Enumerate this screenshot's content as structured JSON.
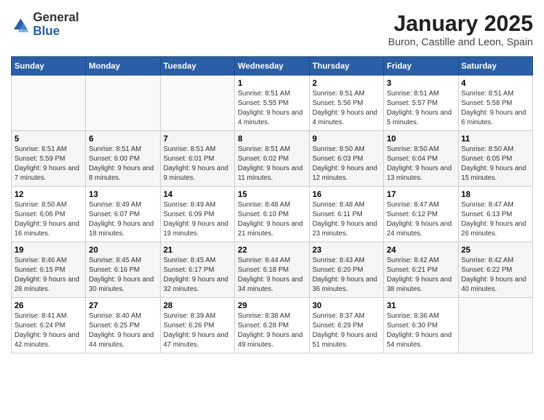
{
  "header": {
    "logo_general": "General",
    "logo_blue": "Blue",
    "title": "January 2025",
    "subtitle": "Buron, Castille and Leon, Spain"
  },
  "columns": [
    "Sunday",
    "Monday",
    "Tuesday",
    "Wednesday",
    "Thursday",
    "Friday",
    "Saturday"
  ],
  "weeks": [
    [
      {
        "day": "",
        "info": ""
      },
      {
        "day": "",
        "info": ""
      },
      {
        "day": "",
        "info": ""
      },
      {
        "day": "1",
        "info": "Sunrise: 8:51 AM\nSunset: 5:55 PM\nDaylight: 9 hours and 4 minutes."
      },
      {
        "day": "2",
        "info": "Sunrise: 8:51 AM\nSunset: 5:56 PM\nDaylight: 9 hours and 4 minutes."
      },
      {
        "day": "3",
        "info": "Sunrise: 8:51 AM\nSunset: 5:57 PM\nDaylight: 9 hours and 5 minutes."
      },
      {
        "day": "4",
        "info": "Sunrise: 8:51 AM\nSunset: 5:58 PM\nDaylight: 9 hours and 6 minutes."
      }
    ],
    [
      {
        "day": "5",
        "info": "Sunrise: 8:51 AM\nSunset: 5:59 PM\nDaylight: 9 hours and 7 minutes."
      },
      {
        "day": "6",
        "info": "Sunrise: 8:51 AM\nSunset: 6:00 PM\nDaylight: 9 hours and 8 minutes."
      },
      {
        "day": "7",
        "info": "Sunrise: 8:51 AM\nSunset: 6:01 PM\nDaylight: 9 hours and 9 minutes."
      },
      {
        "day": "8",
        "info": "Sunrise: 8:51 AM\nSunset: 6:02 PM\nDaylight: 9 hours and 11 minutes."
      },
      {
        "day": "9",
        "info": "Sunrise: 8:50 AM\nSunset: 6:03 PM\nDaylight: 9 hours and 12 minutes."
      },
      {
        "day": "10",
        "info": "Sunrise: 8:50 AM\nSunset: 6:04 PM\nDaylight: 9 hours and 13 minutes."
      },
      {
        "day": "11",
        "info": "Sunrise: 8:50 AM\nSunset: 6:05 PM\nDaylight: 9 hours and 15 minutes."
      }
    ],
    [
      {
        "day": "12",
        "info": "Sunrise: 8:50 AM\nSunset: 6:06 PM\nDaylight: 9 hours and 16 minutes."
      },
      {
        "day": "13",
        "info": "Sunrise: 8:49 AM\nSunset: 6:07 PM\nDaylight: 9 hours and 18 minutes."
      },
      {
        "day": "14",
        "info": "Sunrise: 8:49 AM\nSunset: 6:09 PM\nDaylight: 9 hours and 19 minutes."
      },
      {
        "day": "15",
        "info": "Sunrise: 8:48 AM\nSunset: 6:10 PM\nDaylight: 9 hours and 21 minutes."
      },
      {
        "day": "16",
        "info": "Sunrise: 8:48 AM\nSunset: 6:11 PM\nDaylight: 9 hours and 23 minutes."
      },
      {
        "day": "17",
        "info": "Sunrise: 8:47 AM\nSunset: 6:12 PM\nDaylight: 9 hours and 24 minutes."
      },
      {
        "day": "18",
        "info": "Sunrise: 8:47 AM\nSunset: 6:13 PM\nDaylight: 9 hours and 26 minutes."
      }
    ],
    [
      {
        "day": "19",
        "info": "Sunrise: 8:46 AM\nSunset: 6:15 PM\nDaylight: 9 hours and 28 minutes."
      },
      {
        "day": "20",
        "info": "Sunrise: 8:45 AM\nSunset: 6:16 PM\nDaylight: 9 hours and 30 minutes."
      },
      {
        "day": "21",
        "info": "Sunrise: 8:45 AM\nSunset: 6:17 PM\nDaylight: 9 hours and 32 minutes."
      },
      {
        "day": "22",
        "info": "Sunrise: 8:44 AM\nSunset: 6:18 PM\nDaylight: 9 hours and 34 minutes."
      },
      {
        "day": "23",
        "info": "Sunrise: 8:43 AM\nSunset: 6:20 PM\nDaylight: 9 hours and 36 minutes."
      },
      {
        "day": "24",
        "info": "Sunrise: 8:42 AM\nSunset: 6:21 PM\nDaylight: 9 hours and 38 minutes."
      },
      {
        "day": "25",
        "info": "Sunrise: 8:42 AM\nSunset: 6:22 PM\nDaylight: 9 hours and 40 minutes."
      }
    ],
    [
      {
        "day": "26",
        "info": "Sunrise: 8:41 AM\nSunset: 6:24 PM\nDaylight: 9 hours and 42 minutes."
      },
      {
        "day": "27",
        "info": "Sunrise: 8:40 AM\nSunset: 6:25 PM\nDaylight: 9 hours and 44 minutes."
      },
      {
        "day": "28",
        "info": "Sunrise: 8:39 AM\nSunset: 6:26 PM\nDaylight: 9 hours and 47 minutes."
      },
      {
        "day": "29",
        "info": "Sunrise: 8:38 AM\nSunset: 6:28 PM\nDaylight: 9 hours and 49 minutes."
      },
      {
        "day": "30",
        "info": "Sunrise: 8:37 AM\nSunset: 6:29 PM\nDaylight: 9 hours and 51 minutes."
      },
      {
        "day": "31",
        "info": "Sunrise: 8:36 AM\nSunset: 6:30 PM\nDaylight: 9 hours and 54 minutes."
      },
      {
        "day": "",
        "info": ""
      }
    ]
  ]
}
